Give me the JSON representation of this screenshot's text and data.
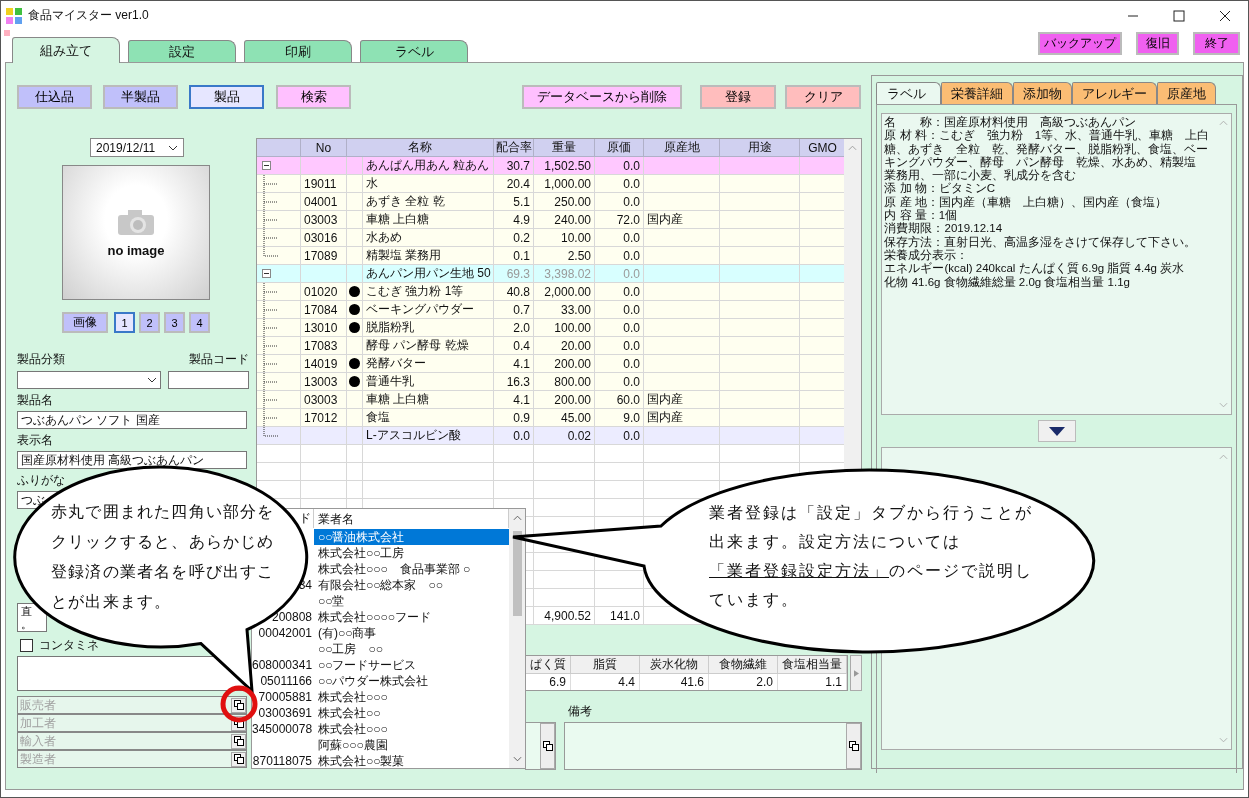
{
  "window": {
    "title": "食品マイスター ver1.0"
  },
  "main_tabs": [
    {
      "label": "組み立て",
      "selected": true
    },
    {
      "label": "設定",
      "selected": false
    },
    {
      "label": "印刷",
      "selected": false
    },
    {
      "label": "ラベル",
      "selected": false
    }
  ],
  "header_buttons": [
    "バックアップ",
    "復旧",
    "終了"
  ],
  "modes": [
    {
      "label": "仕込品",
      "selected": false
    },
    {
      "label": "半製品",
      "selected": false
    },
    {
      "label": "製品",
      "selected": true
    }
  ],
  "tools": [
    {
      "label": "検索",
      "kind": "search"
    },
    {
      "label": "データベースから削除",
      "kind": "delete"
    },
    {
      "label": "登録",
      "kind": "register"
    },
    {
      "label": "クリア",
      "kind": "clear"
    }
  ],
  "product": {
    "date": "2019/12/11",
    "image_placeholder": "no image",
    "image_button": "画像",
    "image_slots": [
      {
        "label": "1",
        "selected": true
      },
      {
        "label": "2",
        "selected": false
      },
      {
        "label": "3",
        "selected": false
      },
      {
        "label": "4",
        "selected": false
      }
    ],
    "category": {
      "label": "製品分類"
    },
    "code": {
      "label": "製品コード"
    },
    "name": {
      "label": "製品名",
      "value": "つぶあんパン ソフト 国産"
    },
    "display_name": {
      "label": "表示名",
      "value": "国産原材料使用 高級つぶあんパン"
    },
    "furigana": {
      "label": "ふりがな",
      "value": "つぶ"
    },
    "memo": {
      "lines": [
        "直",
        "。"
      ]
    },
    "contamination": {
      "label": "コンタミネ",
      "checked": false
    },
    "vendors": [
      {
        "placeholder": "販売者"
      },
      {
        "placeholder": "加工者"
      },
      {
        "placeholder": "輸入者"
      },
      {
        "placeholder": "製造者"
      }
    ]
  },
  "ingredients": {
    "columns": [
      "No",
      "名称",
      "配合率",
      "重量",
      "原価",
      "原産地",
      "用途",
      "GMO"
    ],
    "rows": [
      {
        "name": "あんぱん用あん 粒あん",
        "rate": "30.7",
        "weight": "1,502.50",
        "cost": "0.0",
        "expanded": true,
        "dimmed": false,
        "color": "#ffc8ff",
        "children": [
          {
            "no": "19011",
            "name": "水",
            "allergen": false,
            "rate": "20.4",
            "weight": "1,000.00",
            "cost": "0.0",
            "kind": "ingredient"
          },
          {
            "no": "04001",
            "name": "あずき 全粒 乾",
            "allergen": false,
            "rate": "5.1",
            "weight": "250.00",
            "cost": "0.0",
            "kind": "ingredient"
          },
          {
            "no": "03003",
            "name": "車糖 上白糖",
            "allergen": false,
            "rate": "4.9",
            "weight": "240.00",
            "cost": "72.0",
            "origin": "国内産",
            "kind": "ingredient"
          },
          {
            "no": "03016",
            "name": "水あめ",
            "allergen": false,
            "rate": "0.2",
            "weight": "10.00",
            "cost": "0.0",
            "kind": "ingredient"
          },
          {
            "no": "17089",
            "name": "精製塩 業務用",
            "allergen": false,
            "rate": "0.1",
            "weight": "2.50",
            "cost": "0.0",
            "kind": "ingredient"
          }
        ]
      },
      {
        "name": "あんパン用パン生地 50",
        "rate": "69.3",
        "weight": "3,398.02",
        "cost": "0.0",
        "expanded": true,
        "dimmed": true,
        "color": "#d8ffff",
        "children": [
          {
            "no": "01020",
            "name": "こむぎ 強力粉 1等",
            "allergen": true,
            "rate": "40.8",
            "weight": "2,000.00",
            "cost": "0.0",
            "kind": "ingredient"
          },
          {
            "no": "17084",
            "name": "ベーキングパウダー",
            "allergen": true,
            "rate": "0.7",
            "weight": "33.00",
            "cost": "0.0",
            "kind": "ingredient"
          },
          {
            "no": "13010",
            "name": "脱脂粉乳",
            "allergen": true,
            "rate": "2.0",
            "weight": "100.00",
            "cost": "0.0",
            "kind": "ingredient"
          },
          {
            "no": "17083",
            "name": "酵母 パン酵母 乾燥",
            "allergen": false,
            "rate": "0.4",
            "weight": "20.00",
            "cost": "0.0",
            "kind": "ingredient"
          },
          {
            "no": "14019",
            "name": "発酵バター",
            "allergen": true,
            "rate": "4.1",
            "weight": "200.00",
            "cost": "0.0",
            "kind": "ingredient"
          },
          {
            "no": "13003",
            "name": "普通牛乳",
            "allergen": true,
            "rate": "16.3",
            "weight": "800.00",
            "cost": "0.0",
            "kind": "ingredient"
          },
          {
            "no": "03003",
            "name": "車糖 上白糖",
            "allergen": false,
            "rate": "4.1",
            "weight": "200.00",
            "cost": "60.0",
            "origin": "国内産",
            "kind": "ingredient"
          },
          {
            "no": "17012",
            "name": "食塩",
            "allergen": false,
            "rate": "0.9",
            "weight": "45.00",
            "cost": "9.0",
            "origin": "国内産",
            "kind": "ingredient"
          },
          {
            "name": "L-アスコルビン酸",
            "allergen": false,
            "rate": "0.0",
            "weight": "0.02",
            "cost": "0.0",
            "kind": "additive"
          }
        ]
      }
    ],
    "totals": {
      "weight": "4,900.52",
      "cost": "141.0"
    }
  },
  "nutrition": {
    "columns": [
      "ぱく質",
      "脂質",
      "炭水化物",
      "食物繊維",
      "食塩相当量"
    ],
    "values": [
      "6.9",
      "4.4",
      "41.6",
      "2.0",
      "1.1"
    ]
  },
  "remarks": {
    "label": "備考"
  },
  "label_panel": {
    "tabs": [
      {
        "label": "ラベル",
        "selected": true
      },
      {
        "label": "栄養詳細",
        "selected": false
      },
      {
        "label": "添加物",
        "selected": false
      },
      {
        "label": "アレルギー",
        "selected": false
      },
      {
        "label": "原産地",
        "selected": false
      }
    ],
    "lines": [
      "名　　称：国産原材料使用　高級つぶあんパン",
      "原 材 料：こむぎ　強力粉　1等、水、普通牛乳、車糖　上白",
      "糖、あずき　全粒　乾、発酵バター、脱脂粉乳、食塩、ベー",
      "キングパウダー、酵母　パン酵母　乾燥、水あめ、精製塩",
      "業務用、一部に小麦、乳成分を含む",
      "添 加 物：ビタミンC",
      "原 産 地：国内産（車糖　上白糖）、国内産（食塩）",
      "内 容 量：1個",
      "消費期限：2019.12.14",
      "保存方法：直射日光、高温多湿をさけて保存して下さい。",
      "栄養成分表示：",
      "エネルギー(kcal) 240kcal たんぱく質 6.9g 脂質 4.4g 炭水",
      "化物 41.6g 食物繊維総量 2.0g 食塩相当量 1.1g"
    ]
  },
  "vendor_list": {
    "columns": [
      "ド",
      "業者名"
    ],
    "rows": [
      {
        "name": "○○醤油株式会社",
        "selected": true
      },
      {
        "name": "株式会社○○工房",
        "selected": false
      },
      {
        "name": "株式会社○○○　食品事業部 ○",
        "selected": false
      },
      {
        "code": "34",
        "name": "有限会社○○総本家　○○",
        "selected": false
      },
      {
        "name": "○○堂",
        "selected": false
      },
      {
        "code": "200808",
        "name": "株式会社○○○○フード",
        "selected": false
      },
      {
        "code": "00042001",
        "name": "(有)○○商事",
        "selected": false
      },
      {
        "name": "○○工房　○○",
        "selected": false
      },
      {
        "code": "608000341",
        "name": "○○フードサービス",
        "selected": false
      },
      {
        "code": "05011166",
        "name": "○○パウダー株式会社",
        "selected": false
      },
      {
        "code": "70005881",
        "name": "株式会社○○○",
        "selected": false
      },
      {
        "code": "03003691",
        "name": "株式会社○○",
        "selected": false
      },
      {
        "code": "345000078",
        "name": "株式会社○○○",
        "selected": false
      },
      {
        "name": "阿蘇○○○農園",
        "selected": false
      },
      {
        "code": "870118075",
        "name": "株式会社○○製菓",
        "selected": false
      }
    ]
  },
  "callout_left": {
    "lines": [
      "赤丸で囲まれた四角い部分を",
      "クリックすると、あらかじめ",
      "登録済の業者名を呼び出すこ",
      "とが出来ます。"
    ]
  },
  "callout_right": {
    "text_before": "業者登録は「設定」タブから行うことが出来ます。設定方法については",
    "link": "「業者登録設定方法」",
    "text_after": "のページで説明しています。"
  }
}
